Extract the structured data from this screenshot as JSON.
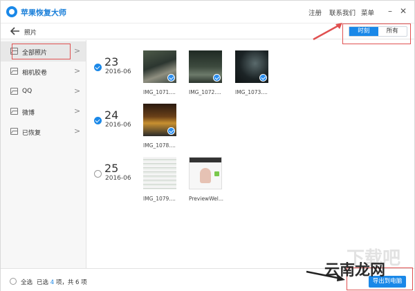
{
  "app": {
    "title": "苹果恢复大师",
    "links": [
      "注册",
      "联系我们",
      "菜单"
    ],
    "minimize_icon": "minimize-icon",
    "close_icon": "close-icon",
    "brand_color": "#1a88e8"
  },
  "toolbar": {
    "back_icon": "back-arrow-icon",
    "title": "照片",
    "segments": [
      {
        "label": "时刻",
        "selected": true
      },
      {
        "label": "所有",
        "selected": false
      }
    ]
  },
  "sidebar": {
    "items": [
      {
        "label": "全部照片",
        "icon": "document-icon",
        "selected": true
      },
      {
        "label": "相机胶卷",
        "icon": "image-icon",
        "selected": false
      },
      {
        "label": "QQ",
        "icon": "image-icon",
        "selected": false
      },
      {
        "label": "微博",
        "icon": "image-icon",
        "selected": false
      },
      {
        "label": "已恢复",
        "icon": "image-icon",
        "selected": false
      }
    ]
  },
  "groups": [
    {
      "day": "23",
      "month": "2016-06",
      "checked": true,
      "photos": [
        {
          "caption": "IMG_1071....",
          "checked": true
        },
        {
          "caption": "IMG_1072....",
          "checked": true
        },
        {
          "caption": "IMG_1073....",
          "checked": true
        }
      ]
    },
    {
      "day": "24",
      "month": "2016-06",
      "checked": true,
      "photos": [
        {
          "caption": "IMG_1078....",
          "checked": true
        }
      ]
    },
    {
      "day": "25",
      "month": "2016-06",
      "checked": false,
      "photos": [
        {
          "caption": "IMG_1079....",
          "checked": false
        },
        {
          "caption": "PreviewWel...",
          "checked": false
        }
      ]
    }
  ],
  "bottom": {
    "select_all_label": "全选",
    "selected_prefix": "已选",
    "selected_count": "4",
    "selected_suffix": "项，共 6 项",
    "export_label": "导出到电脑"
  },
  "watermark": {
    "text": "云南龙网",
    "ghost_text": "下载吧"
  },
  "annotation_color": "#e05050"
}
